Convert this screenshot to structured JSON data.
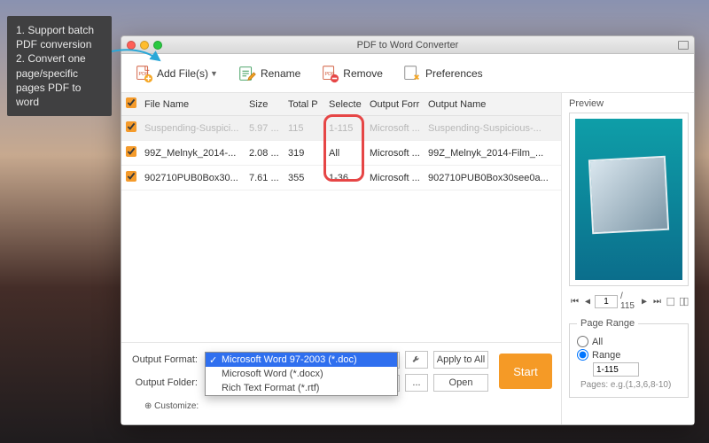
{
  "callout": {
    "line1": "1. Support batch PDF conversion",
    "line2": "2. Convert one page/specific pages PDF to word"
  },
  "window": {
    "title": "PDF to Word Converter"
  },
  "toolbar": {
    "add_files": "Add File(s)",
    "rename": "Rename",
    "remove": "Remove",
    "preferences": "Preferences"
  },
  "table": {
    "headers": {
      "file_name": "File Name",
      "size": "Size",
      "total_p": "Total P",
      "selected": "Selecte",
      "output_format": "Output Forr",
      "output_name": "Output Name"
    },
    "rows": [
      {
        "checked": true,
        "selected_row": true,
        "name": "Suspending-Suspici...",
        "size": "5.97 ...",
        "total": "115",
        "sel": "1-115",
        "fmt": "Microsoft ...",
        "out": "Suspending-Suspicious-..."
      },
      {
        "checked": true,
        "selected_row": false,
        "name": "99Z_Melnyk_2014-...",
        "size": "2.08 ...",
        "total": "319",
        "sel": "All",
        "fmt": "Microsoft ...",
        "out": "99Z_Melnyk_2014-Film_..."
      },
      {
        "checked": true,
        "selected_row": false,
        "name": "902710PUB0Box30...",
        "size": "7.61 ...",
        "total": "355",
        "sel": "1-36",
        "fmt": "Microsoft ...",
        "out": "902710PUB0Box30see0a..."
      }
    ]
  },
  "bottom": {
    "output_format_label": "Output Format:",
    "output_folder_label": "Output Folder:",
    "apply_to_all": "Apply to All",
    "open": "Open",
    "start": "Start",
    "customize": "Customize:",
    "dots": "...",
    "format_options": [
      {
        "label": "Microsoft Word 97-2003 (*.doc)",
        "selected": true
      },
      {
        "label": "Microsoft Word (*.docx)",
        "selected": false
      },
      {
        "label": "Rich Text Format (*.rtf)",
        "selected": false
      }
    ]
  },
  "preview": {
    "label": "Preview",
    "page_current": "1",
    "page_total": "/ 115",
    "range_legend": "Page Range",
    "opt_all": "All",
    "opt_range": "Range",
    "range_value": "1-115",
    "hint": "Pages: e.g.(1,3,6,8-10)"
  }
}
